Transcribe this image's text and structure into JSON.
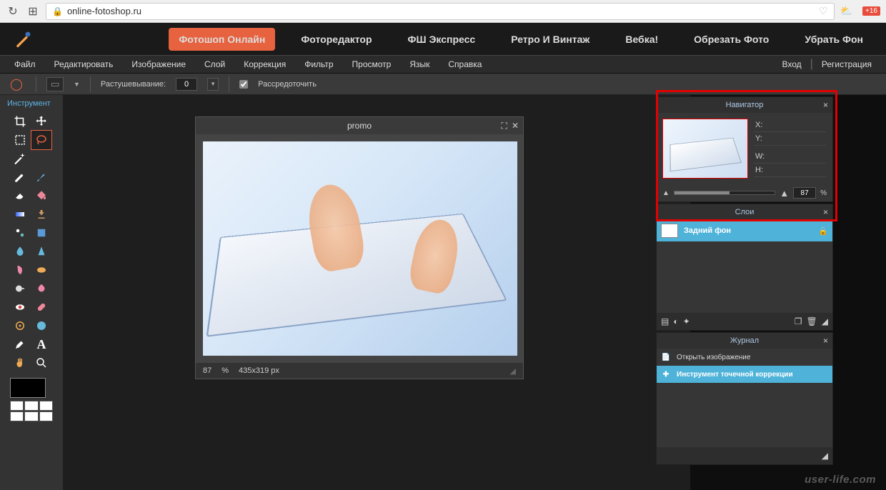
{
  "browser": {
    "url": "online-fotoshop.ru",
    "badge": "+16"
  },
  "topnav": {
    "items": [
      "Фотошоп Онлайн",
      "Фоторедактор",
      "ФШ Экспресс",
      "Ретро И Винтаж",
      "Вебка!",
      "Обрезать Фото",
      "Убрать Фон"
    ]
  },
  "menubar": {
    "items": [
      "Файл",
      "Редактировать",
      "Изображение",
      "Слой",
      "Коррекция",
      "Фильтр",
      "Просмотр",
      "Язык",
      "Справка"
    ],
    "login": "Вход",
    "register": "Регистрация"
  },
  "options": {
    "feather_label": "Растушевывание:",
    "feather_value": "0",
    "spread_label": "Рассредоточить"
  },
  "toolbox": {
    "title": "Инструмент"
  },
  "document": {
    "title": "promo",
    "zoom": "87",
    "zoom_unit": "%",
    "dims": "435x319 px"
  },
  "panels": {
    "navigator": {
      "title": "Навигатор",
      "x_label": "X:",
      "y_label": "Y:",
      "w_label": "W:",
      "h_label": "H:",
      "zoom": "87",
      "zoom_unit": "%"
    },
    "layers": {
      "title": "Слои",
      "bg_layer": "Задний фон"
    },
    "history": {
      "title": "Журнал",
      "items": [
        "Открыть изображение",
        "Инструмент точечной коррекции"
      ]
    }
  },
  "watermark": "user-life.com"
}
